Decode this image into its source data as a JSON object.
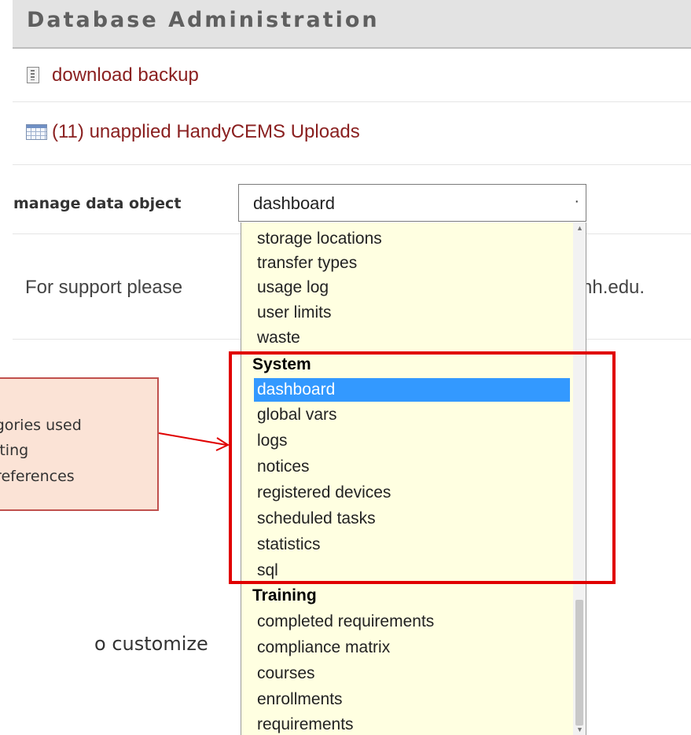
{
  "header": {
    "title": "Database Administration"
  },
  "rows": {
    "download_backup": {
      "icon": "zip-file-icon",
      "label": "download backup"
    },
    "uploads": {
      "icon": "table-grid-icon",
      "label": "(11) unapplied HandyCEMS Uploads"
    }
  },
  "manage": {
    "label": "manage data object",
    "selected": "dashboard"
  },
  "support": {
    "prefix": "For support please",
    "suffix": "nh.edu."
  },
  "behind_text": "o customize",
  "callout": {
    "lines": [
      "egories used",
      "diting",
      "preferences"
    ]
  },
  "dropdown": {
    "items_before": [
      "storage locations",
      "transfer types",
      "usage log",
      "user limits",
      "waste"
    ],
    "group_system": "System",
    "system_items": [
      "dashboard",
      "global vars",
      "logs",
      "notices",
      "registered devices",
      "scheduled tasks",
      "statistics",
      "sql"
    ],
    "group_training": "Training",
    "training_items": [
      "completed requirements",
      "compliance matrix",
      "courses",
      "enrollments",
      "requirements"
    ]
  },
  "colors": {
    "link": "#8a2020",
    "selection": "#3399ff",
    "dropdown_bg": "#ffffe1",
    "highlight_box": "#e00000",
    "callout_bg": "#fbe3d6"
  }
}
